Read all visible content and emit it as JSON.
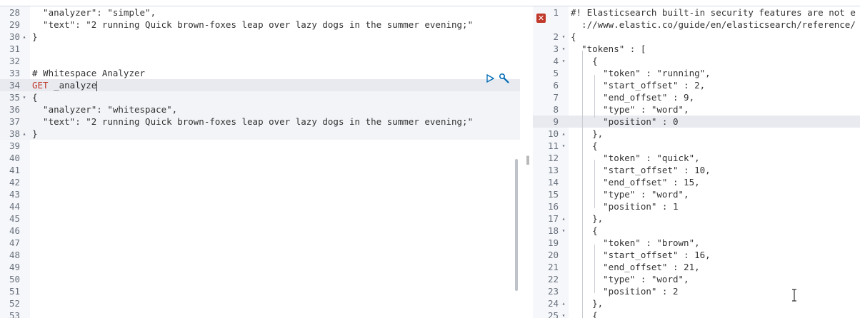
{
  "left": {
    "lines": [
      {
        "n": "28",
        "fold": "",
        "t": "  \"analyzer\": \"simple\","
      },
      {
        "n": "29",
        "fold": "",
        "t": "  \"text\": \"2 running Quick brown-foxes leap over lazy dogs in the summer evening;\""
      },
      {
        "n": "30",
        "fold": "▴",
        "t": "}"
      },
      {
        "n": "31",
        "fold": "",
        "t": ""
      },
      {
        "n": "32",
        "fold": "",
        "t": ""
      },
      {
        "n": "33",
        "fold": "",
        "t": "# Whitespace Analyzer"
      },
      {
        "n": "34",
        "fold": "",
        "t": "",
        "method": "GET",
        "path": " _analyze"
      },
      {
        "n": "35",
        "fold": "▾",
        "t": "{"
      },
      {
        "n": "36",
        "fold": "",
        "t": "  \"analyzer\": \"whitespace\","
      },
      {
        "n": "37",
        "fold": "",
        "t": "  \"text\": \"2 running Quick brown-foxes leap over lazy dogs in the summer evening;\""
      },
      {
        "n": "38",
        "fold": "▴",
        "t": "}"
      },
      {
        "n": "39",
        "fold": "",
        "t": ""
      },
      {
        "n": "40",
        "fold": "",
        "t": ""
      },
      {
        "n": "41",
        "fold": "",
        "t": ""
      },
      {
        "n": "42",
        "fold": "",
        "t": ""
      },
      {
        "n": "43",
        "fold": "",
        "t": ""
      },
      {
        "n": "44",
        "fold": "",
        "t": ""
      },
      {
        "n": "45",
        "fold": "",
        "t": ""
      },
      {
        "n": "46",
        "fold": "",
        "t": ""
      },
      {
        "n": "47",
        "fold": "",
        "t": ""
      },
      {
        "n": "48",
        "fold": "",
        "t": ""
      },
      {
        "n": "49",
        "fold": "",
        "t": ""
      },
      {
        "n": "50",
        "fold": "",
        "t": ""
      },
      {
        "n": "51",
        "fold": "",
        "t": ""
      },
      {
        "n": "52",
        "fold": "",
        "t": ""
      },
      {
        "n": "53",
        "fold": "",
        "t": ""
      }
    ]
  },
  "right": {
    "lines": [
      {
        "n": "1",
        "fold": "",
        "t": "#! Elasticsearch built-in security features are not e"
      },
      {
        "n": "",
        "fold": "",
        "t": "  ://www.elastic.co/guide/en/elasticsearch/reference/"
      },
      {
        "n": "2",
        "fold": "▾",
        "t": "{"
      },
      {
        "n": "3",
        "fold": "▾",
        "t": "  \"tokens\" : ["
      },
      {
        "n": "4",
        "fold": "▾",
        "t": "    {"
      },
      {
        "n": "5",
        "fold": "",
        "t": "      \"token\" : \"running\","
      },
      {
        "n": "6",
        "fold": "",
        "t": "      \"start_offset\" : 2,"
      },
      {
        "n": "7",
        "fold": "",
        "t": "      \"end_offset\" : 9,"
      },
      {
        "n": "8",
        "fold": "",
        "t": "      \"type\" : \"word\","
      },
      {
        "n": "9",
        "fold": "",
        "t": "      \"position\" : 0"
      },
      {
        "n": "10",
        "fold": "▴",
        "t": "    },"
      },
      {
        "n": "11",
        "fold": "▾",
        "t": "    {"
      },
      {
        "n": "12",
        "fold": "",
        "t": "      \"token\" : \"quick\","
      },
      {
        "n": "13",
        "fold": "",
        "t": "      \"start_offset\" : 10,"
      },
      {
        "n": "14",
        "fold": "",
        "t": "      \"end_offset\" : 15,"
      },
      {
        "n": "15",
        "fold": "",
        "t": "      \"type\" : \"word\","
      },
      {
        "n": "16",
        "fold": "",
        "t": "      \"position\" : 1"
      },
      {
        "n": "17",
        "fold": "▴",
        "t": "    },"
      },
      {
        "n": "18",
        "fold": "▾",
        "t": "    {"
      },
      {
        "n": "19",
        "fold": "",
        "t": "      \"token\" : \"brown\","
      },
      {
        "n": "20",
        "fold": "",
        "t": "      \"start_offset\" : 16,"
      },
      {
        "n": "21",
        "fold": "",
        "t": "      \"end_offset\" : 21,"
      },
      {
        "n": "22",
        "fold": "",
        "t": "      \"type\" : \"word\","
      },
      {
        "n": "23",
        "fold": "",
        "t": "      \"position\" : 2"
      },
      {
        "n": "24",
        "fold": "▴",
        "t": "    },"
      },
      {
        "n": "25",
        "fold": "▾",
        "t": "    {"
      }
    ]
  },
  "icons": {
    "error": "error-x-icon",
    "play": "play-icon",
    "settings": "wrench-icon",
    "splitter": "resize-handle-icon",
    "cursor": "text-cursor-icon"
  },
  "colors": {
    "method": "#c0392b",
    "active_line": "#e8eaef",
    "request_block": "#f2f4f7",
    "gutter": "#f5f7fa",
    "action_icon": "#006bb4"
  }
}
